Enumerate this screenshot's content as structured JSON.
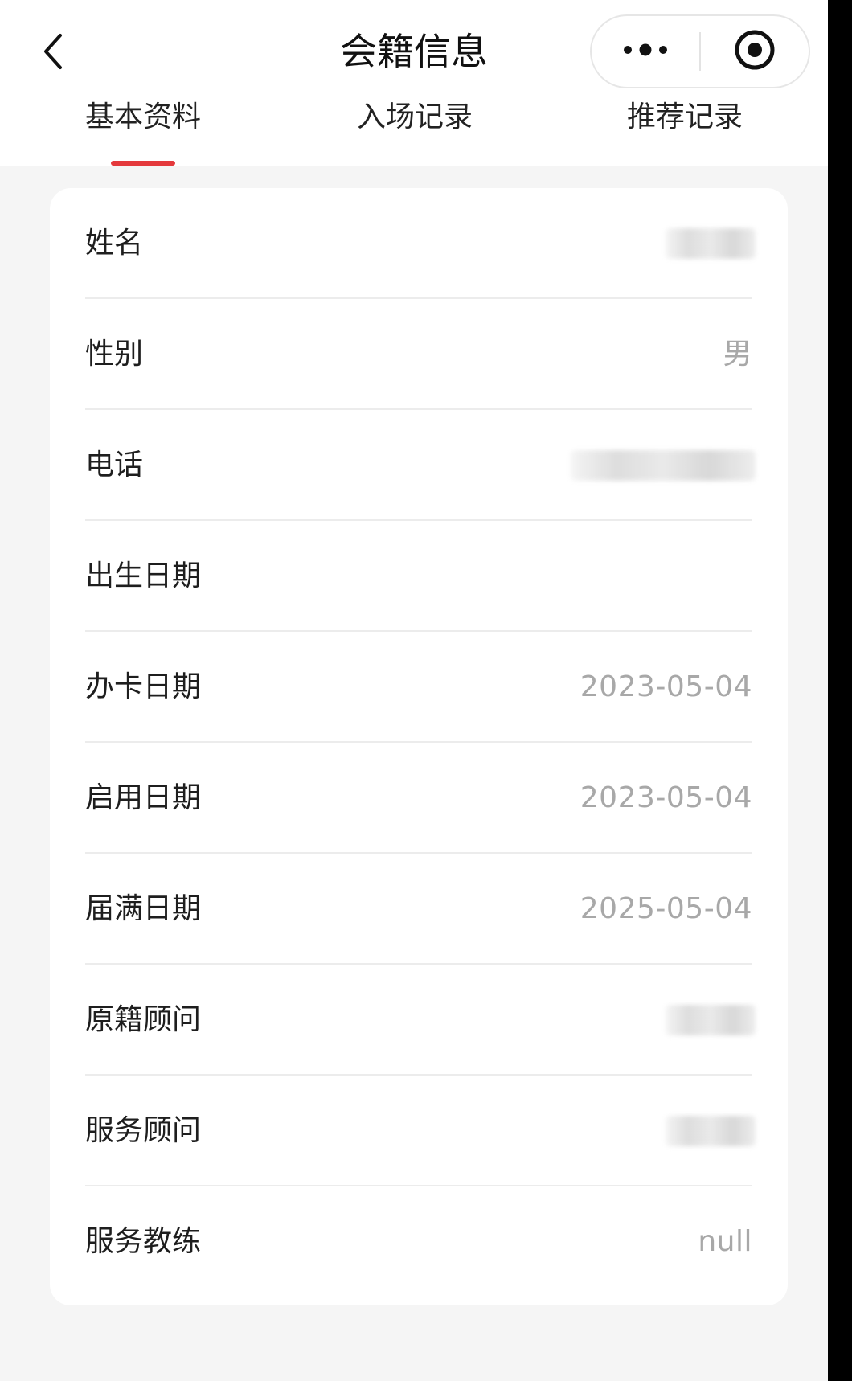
{
  "header": {
    "title": "会籍信息",
    "back_icon": "chevron-left-icon",
    "more_icon": "more-dots-icon",
    "close_icon": "target-circle-icon"
  },
  "tabs": [
    {
      "label": "基本资料",
      "active": true
    },
    {
      "label": "入场记录",
      "active": false
    },
    {
      "label": "推荐记录",
      "active": false
    }
  ],
  "accent_color": "#e4393c",
  "fields": [
    {
      "label": "姓名",
      "value": "",
      "redacted": true
    },
    {
      "label": "性别",
      "value": "男",
      "redacted": false
    },
    {
      "label": "电话",
      "value": "",
      "redacted": true
    },
    {
      "label": "出生日期",
      "value": "",
      "redacted": false
    },
    {
      "label": "办卡日期",
      "value": "2023-05-04",
      "redacted": false
    },
    {
      "label": "启用日期",
      "value": "2023-05-04",
      "redacted": false
    },
    {
      "label": "届满日期",
      "value": "2025-05-04",
      "redacted": false
    },
    {
      "label": "原籍顾问",
      "value": "",
      "redacted": true
    },
    {
      "label": "服务顾问",
      "value": "",
      "redacted": true
    },
    {
      "label": "服务教练",
      "value": "null",
      "redacted": false
    }
  ]
}
